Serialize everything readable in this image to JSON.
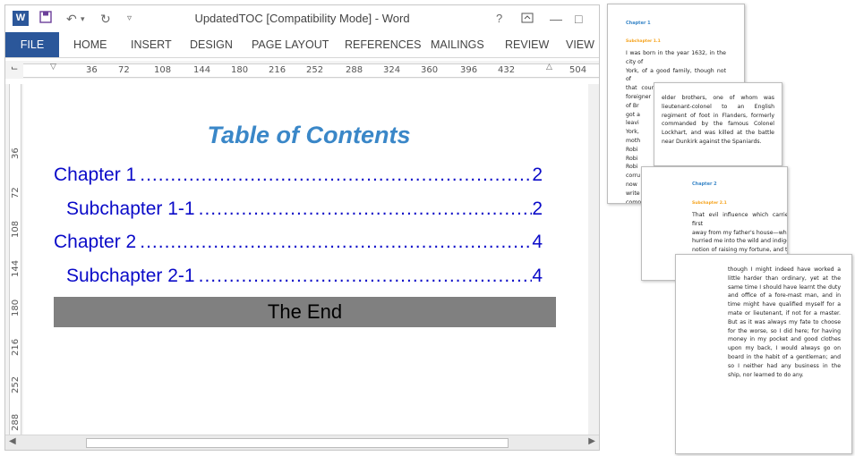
{
  "window": {
    "title": "UpdatedTOC [Compatibility Mode] - Word",
    "logo": "W",
    "help": "?"
  },
  "tabs": [
    "FILE",
    "HOME",
    "INSERT",
    "DESIGN",
    "PAGE LAYOUT",
    "REFERENCES",
    "MAILINGS",
    "REVIEW",
    "VIEW"
  ],
  "ruler": [
    "36",
    "72",
    "108",
    "144",
    "180",
    "216",
    "252",
    "288",
    "324",
    "360",
    "396",
    "432",
    "504"
  ],
  "vruler": [
    "36",
    "72",
    "108",
    "144",
    "180",
    "216",
    "252",
    "288"
  ],
  "document": {
    "title": "Table of Contents",
    "entries": [
      {
        "label": "Chapter 1",
        "page": "2"
      },
      {
        "label": "Subchapter 1-1",
        "page": "2"
      },
      {
        "label": "Chapter 2",
        "page": "4"
      },
      {
        "label": "Subchapter 2-1",
        "page": "4"
      }
    ],
    "end": "The End"
  },
  "pages": {
    "p1": {
      "heading": "Chapter 1",
      "sub": "Subchapter 1.1",
      "lines": [
        "I was born in the year 1632, in the city of",
        "York, of a good family, though not of",
        "that country, my father being a foreigner",
        "of Br",
        "got a",
        "leavi",
        "York,",
        "moth",
        "Robi",
        "Robi",
        "Robi",
        "corru",
        "now",
        "write",
        "comp"
      ]
    },
    "p2": {
      "text": "elder brothers, one of whom was lieutenant-colonel to an English regiment of foot in Flanders, formerly commanded by the famous Colonel Lockhart, and was killed at the battle near Dunkirk against the Spaniards."
    },
    "p3": {
      "heading": "Chapter 2",
      "sub": "Subchapter 2.1",
      "lines": [
        "That evil influence which carried me first",
        "away from my father's house—which",
        "hurried me into the wild and indigested",
        "notion of raising my fortune, and that",
        "impre",
        "advic",
        "the c",
        "same",
        "upon",
        "prese",
        "enter",
        "board",
        "Africa",
        "a voy",
        "misfo",
        "did n"
      ]
    },
    "p4": {
      "text": "though I might indeed have worked a little harder than ordinary, yet at the same time I should have learnt the duty and office of a fore-mast man, and in time might have qualified myself for a mate or lieutenant, if not for a master. But as it was always my fate to choose for the worse, so I did here; for having money in my pocket and good clothes upon my back, I would always go on board in the habit of a gentleman; and so I neither had any business in the ship, nor learned to do any."
    }
  }
}
